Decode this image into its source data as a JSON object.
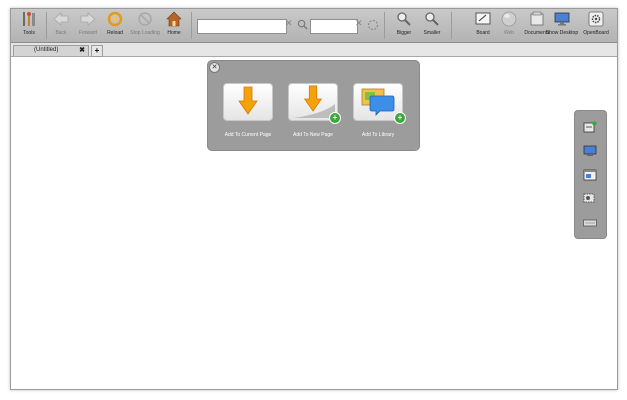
{
  "toolbar": {
    "tools_label": "Tools",
    "back_label": "Back",
    "forward_label": "Forward",
    "reload_label": "Reload",
    "stop_label": "Stop Loading",
    "home_label": "Home",
    "url_value": "",
    "search_value": "",
    "bigger_label": "Bigger",
    "smaller_label": "Smaller",
    "board_label": "Board",
    "web_label": "Web",
    "documents_label": "Documents",
    "show_desktop_label": "Show Desktop",
    "openboard_label": "OpenBoard"
  },
  "tabs": {
    "items": [
      {
        "title": "(Untitled)"
      }
    ],
    "close_glyph": "✖",
    "new_glyph": "+"
  },
  "palette": {
    "close_glyph": "✕",
    "items": [
      {
        "label": "Add To Current Page"
      },
      {
        "label": "Add To New Page"
      },
      {
        "label": "Add To Library"
      }
    ]
  },
  "sidebar": {
    "icons": [
      "capture-add-icon",
      "capture-screen-icon",
      "capture-window-icon",
      "capture-rectangle-icon",
      "keyboard-icon"
    ]
  },
  "colors": {
    "toolbar": "#bdbdbd",
    "palette_bg": "#9c9c9c",
    "arrow_orange": "#f5a10a",
    "plus_green": "#3aa93a"
  }
}
